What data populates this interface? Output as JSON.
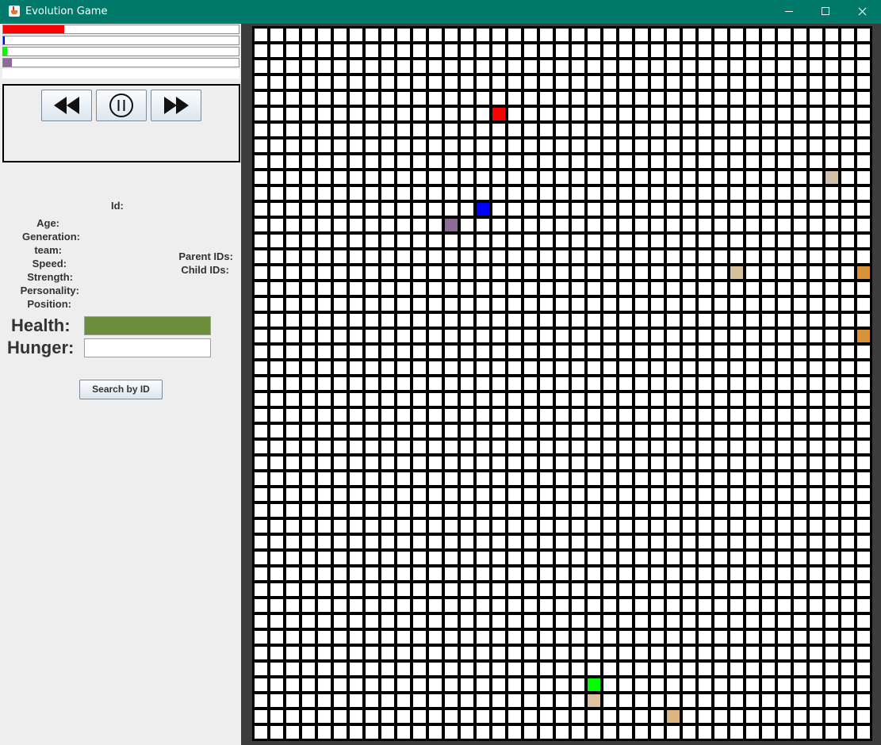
{
  "window": {
    "title": "Evolution Game"
  },
  "team_bars": [
    {
      "name": "red",
      "color": "#ff0000",
      "fraction": 0.26
    },
    {
      "name": "blue",
      "color": "#0000ff",
      "fraction": 0.007
    },
    {
      "name": "green",
      "color": "#00ff00",
      "fraction": 0.017
    },
    {
      "name": "purple",
      "color": "#8e6a99",
      "fraction": 0.037
    }
  ],
  "controls": [
    {
      "name": "rewind-button",
      "icon": "rewind-icon"
    },
    {
      "name": "pause-button",
      "icon": "pause-icon"
    },
    {
      "name": "fast-forward-button",
      "icon": "fast-forward-icon"
    }
  ],
  "info": {
    "id_label": "Id:",
    "age_label": "Age:",
    "generation_label": "Generation:",
    "team_label": "team:",
    "speed_label": "Speed:",
    "strength_label": "Strength:",
    "personality_label": "Personality:",
    "position_label": "Position:",
    "parent_ids_label": "Parent IDs:",
    "child_ids_label": "Child IDs:",
    "health_label": "Health:",
    "hunger_label": "Hunger:",
    "health_fraction": 1.0,
    "health_color": "#6a8e3c",
    "hunger_fraction": 0
  },
  "search_button": "Search by ID",
  "grid": {
    "columns": 39,
    "rows": 45,
    "entities": [
      {
        "col": 15,
        "row": 5,
        "color": "#ff0000"
      },
      {
        "col": 36,
        "row": 9,
        "color": "#d2c0a8"
      },
      {
        "col": 14,
        "row": 11,
        "color": "#0000ff"
      },
      {
        "col": 12,
        "row": 12,
        "color": "#8e6a99"
      },
      {
        "col": 30,
        "row": 15,
        "color": "#d7c09c"
      },
      {
        "col": 38,
        "row": 15,
        "color": "#d89238"
      },
      {
        "col": 38,
        "row": 19,
        "color": "#d89238"
      },
      {
        "col": 21,
        "row": 41,
        "color": "#00ff00"
      },
      {
        "col": 21,
        "row": 42,
        "color": "#dcc4a0"
      },
      {
        "col": 26,
        "row": 43,
        "color": "#ddb580"
      }
    ]
  }
}
